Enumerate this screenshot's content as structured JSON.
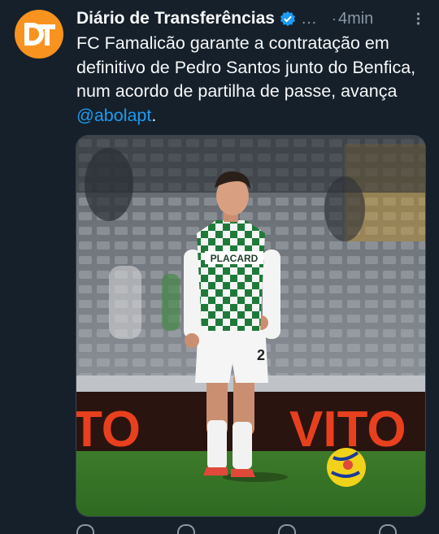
{
  "account": {
    "name": "Diário de Transferências",
    "handle": "…",
    "separator": "·",
    "time": "4min"
  },
  "tweet": {
    "text": "FC Famalicão garante a contratação em definitivo de Pedro Santos junto do Benfica, num acordo de partilha de passe, avança ",
    "mention": "@abolapt",
    "end": "."
  },
  "media": {
    "banner_text": "VITO",
    "banner_text_left": "TO",
    "shirt_sponsor": "PLACARD",
    "shirt_number": "2"
  },
  "colors": {
    "background": "#15202b",
    "accent": "#1d9bf0",
    "avatar": "#f7931e",
    "banner": "#e8401e"
  }
}
